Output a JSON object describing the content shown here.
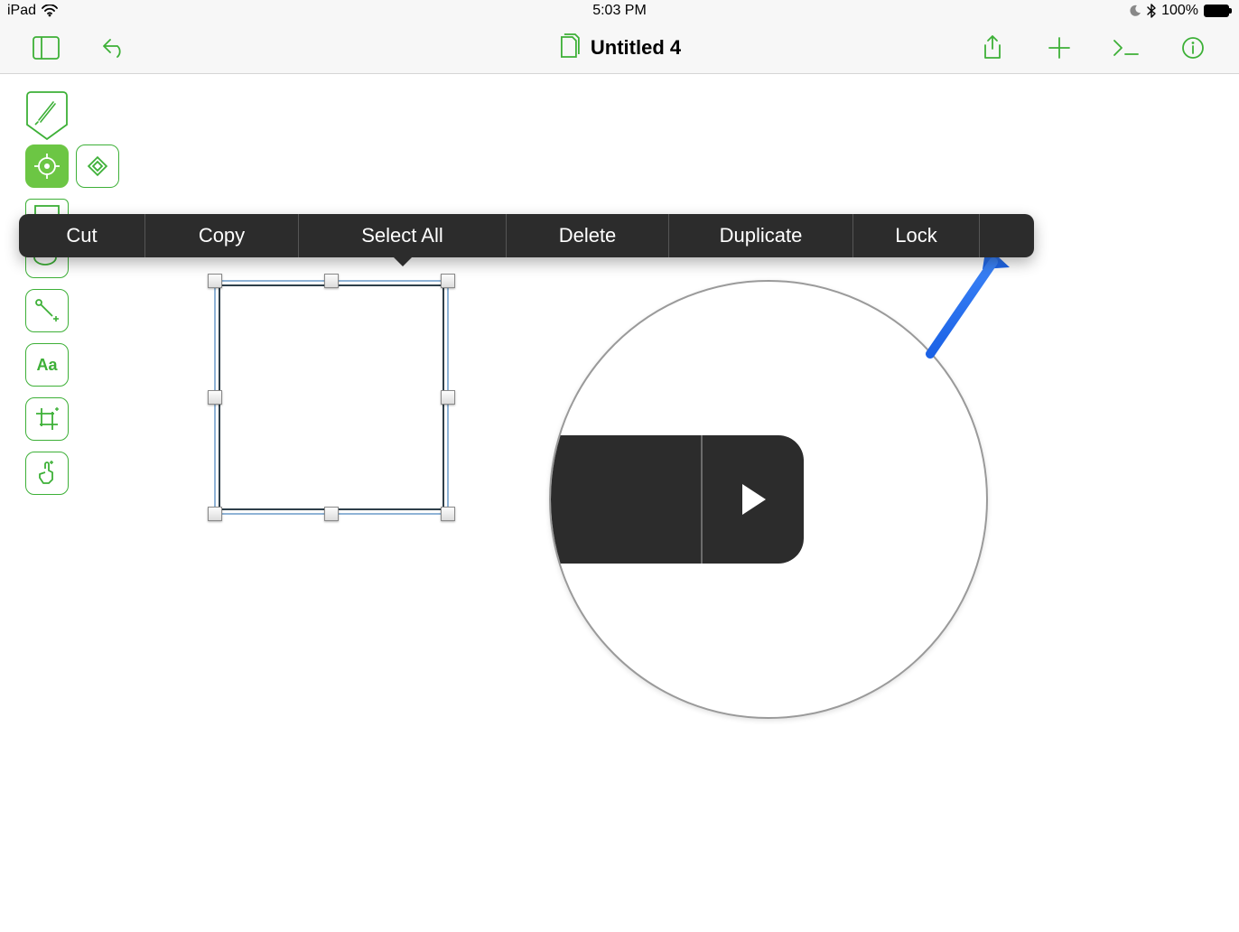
{
  "status": {
    "device": "iPad",
    "time": "5:03 PM",
    "battery_percent": "100%"
  },
  "toolbar": {
    "doc_title": "Untitled 4"
  },
  "ctx_menu": {
    "items": [
      "Cut",
      "Copy",
      "Select All",
      "Delete",
      "Duplicate",
      "Lock"
    ],
    "caret_index": 2
  },
  "tools": {
    "labels": [
      "pen",
      "target",
      "diamond",
      "rect",
      "ellipse",
      "line",
      "text",
      "crop",
      "touch"
    ],
    "text_label": "Aa"
  },
  "colors": {
    "accent": "#3db037",
    "menu_bg": "#2c2c2c",
    "arrow": "#1b62e6"
  }
}
